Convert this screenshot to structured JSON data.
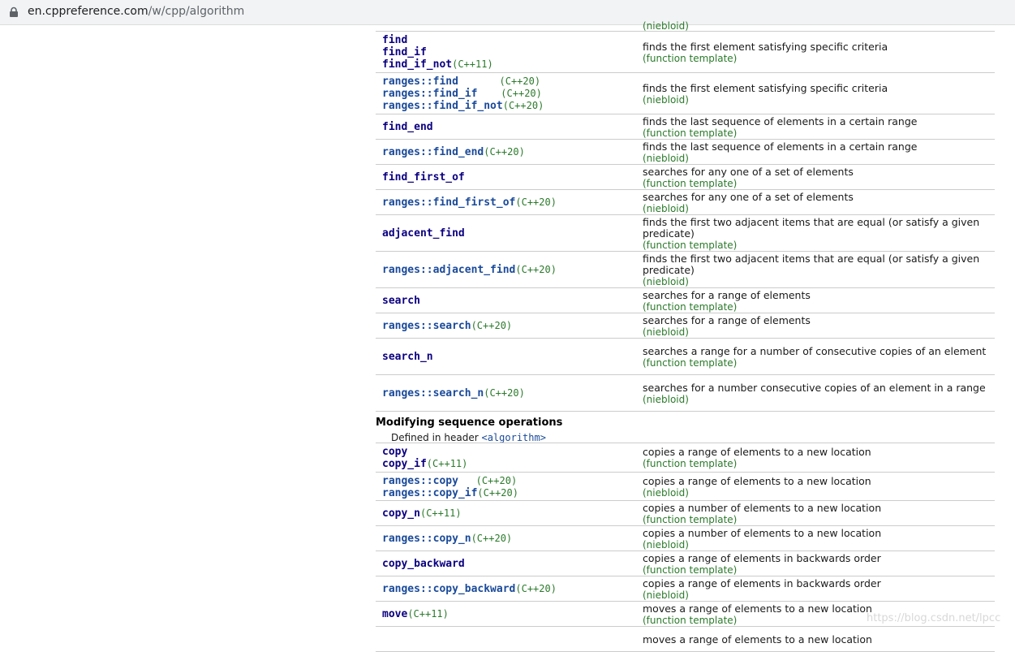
{
  "browser": {
    "url_domain": "en.cppreference.com",
    "url_path": "/w/cpp/algorithm"
  },
  "top_cut_kind": "(niebloid)",
  "rows_a": [
    {
      "names": [
        {
          "n": "find",
          "v": ""
        },
        {
          "n": "find_if",
          "v": ""
        },
        {
          "n": "find_if_not",
          "v": "(C++11)"
        }
      ],
      "desc": "finds the first element satisfying specific criteria",
      "kind": "(function template)"
    },
    {
      "names": [
        {
          "n": "ranges::find",
          "v": "(C++20)"
        },
        {
          "n": "ranges::find_if",
          "v": "(C++20)"
        },
        {
          "n": "ranges::find_if_not",
          "v": "(C++20)"
        }
      ],
      "desc": "finds the first element satisfying specific criteria",
      "kind": "(niebloid)"
    },
    {
      "names": [
        {
          "n": "find_end",
          "v": ""
        }
      ],
      "desc": "finds the last sequence of elements in a certain range",
      "kind": "(function template)"
    },
    {
      "names": [
        {
          "n": "ranges::find_end",
          "v": "(C++20)"
        }
      ],
      "desc": "finds the last sequence of elements in a certain range",
      "kind": "(niebloid)"
    },
    {
      "names": [
        {
          "n": "find_first_of",
          "v": ""
        }
      ],
      "desc": "searches for any one of a set of elements",
      "kind": "(function template)"
    },
    {
      "names": [
        {
          "n": "ranges::find_first_of",
          "v": "(C++20)"
        }
      ],
      "desc": "searches for any one of a set of elements",
      "kind": "(niebloid)"
    },
    {
      "names": [
        {
          "n": "adjacent_find",
          "v": ""
        }
      ],
      "desc": "finds the first two adjacent items that are equal (or satisfy a given predicate)",
      "kind": "(function template)"
    },
    {
      "names": [
        {
          "n": "ranges::adjacent_find",
          "v": "(C++20)"
        }
      ],
      "desc": "finds the first two adjacent items that are equal (or satisfy a given predicate)",
      "kind": "(niebloid)"
    },
    {
      "names": [
        {
          "n": "search",
          "v": ""
        }
      ],
      "desc": "searches for a range of elements",
      "kind": "(function template)"
    },
    {
      "names": [
        {
          "n": "ranges::search",
          "v": "(C++20)"
        }
      ],
      "desc": "searches for a range of elements",
      "kind": "(niebloid)"
    },
    {
      "names": [
        {
          "n": "search_n",
          "v": ""
        }
      ],
      "desc": "searches a range for a number of consecutive copies of an element",
      "kind": "(function template)"
    },
    {
      "names": [
        {
          "n": "ranges::search_n",
          "v": "(C++20)"
        }
      ],
      "desc": "searches for a number consecutive copies of an element in a range",
      "kind": "(niebloid)"
    }
  ],
  "section": {
    "title": "Modifying sequence operations",
    "defined_in": "Defined in header",
    "header": "<algorithm>"
  },
  "rows_b": [
    {
      "names": [
        {
          "n": "copy",
          "v": ""
        },
        {
          "n": "copy_if",
          "v": "(C++11)"
        }
      ],
      "desc": "copies a range of elements to a new location",
      "kind": "(function template)"
    },
    {
      "names": [
        {
          "n": "ranges::copy",
          "v": "(C++20)"
        },
        {
          "n": "ranges::copy_if",
          "v": "(C++20)"
        }
      ],
      "desc": "copies a range of elements to a new location",
      "kind": "(niebloid)"
    },
    {
      "names": [
        {
          "n": "copy_n",
          "v": "(C++11)"
        }
      ],
      "desc": "copies a number of elements to a new location",
      "kind": "(function template)"
    },
    {
      "names": [
        {
          "n": "ranges::copy_n",
          "v": "(C++20)"
        }
      ],
      "desc": "copies a number of elements to a new location",
      "kind": "(niebloid)"
    },
    {
      "names": [
        {
          "n": "copy_backward",
          "v": ""
        }
      ],
      "desc": "copies a range of elements in backwards order",
      "kind": "(function template)"
    },
    {
      "names": [
        {
          "n": "ranges::copy_backward",
          "v": "(C++20)"
        }
      ],
      "desc": "copies a range of elements in backwards order",
      "kind": "(niebloid)"
    },
    {
      "names": [
        {
          "n": "move",
          "v": "(C++11)"
        }
      ],
      "desc": "moves a range of elements to a new location",
      "kind": "(function template)"
    },
    {
      "names": [],
      "desc": "moves a range of elements to a new location",
      "kind": ""
    }
  ],
  "watermark": "https://blog.csdn.net/lpcc"
}
